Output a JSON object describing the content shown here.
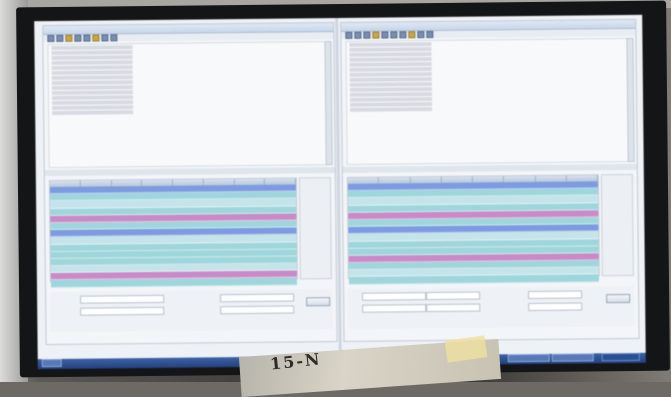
{
  "photo": {
    "paper_label": "15-N"
  },
  "left_pane": {
    "title": "",
    "table_headers": [
      "",
      "",
      "",
      "",
      "",
      "",
      "",
      ""
    ],
    "rows": [
      {
        "style": "blue"
      },
      {
        "style": "cyan"
      },
      {
        "style": "light"
      },
      {
        "style": "cyan"
      },
      {
        "style": "magenta"
      },
      {
        "style": "cyan"
      },
      {
        "style": "blue"
      },
      {
        "style": "light"
      },
      {
        "style": "cyan"
      },
      {
        "style": "cyan"
      },
      {
        "style": "cyan"
      },
      {
        "style": "light"
      },
      {
        "style": "magenta"
      },
      {
        "style": "cyan"
      }
    ],
    "form": {
      "field1": "",
      "field2": "",
      "field3": "",
      "button": ""
    }
  },
  "right_pane": {
    "title": "",
    "table_headers": [
      "",
      "",
      "",
      "",
      "",
      "",
      "",
      ""
    ],
    "rows": [
      {
        "style": "blue"
      },
      {
        "style": "cyan"
      },
      {
        "style": "light"
      },
      {
        "style": "cyan"
      },
      {
        "style": "magenta"
      },
      {
        "style": "cyan"
      },
      {
        "style": "blue"
      },
      {
        "style": "light"
      },
      {
        "style": "cyan"
      },
      {
        "style": "cyan"
      },
      {
        "style": "magenta"
      },
      {
        "style": "cyan"
      },
      {
        "style": "light"
      },
      {
        "style": "cyan"
      }
    ],
    "form": {
      "field1": "",
      "field2": "",
      "field3": "",
      "button": ""
    }
  },
  "colors": {
    "row_cyan": "#9fd6dc",
    "row_magenta": "#c98ac7",
    "row_blue": "#7d9be0",
    "taskbar": "#2f559b"
  }
}
